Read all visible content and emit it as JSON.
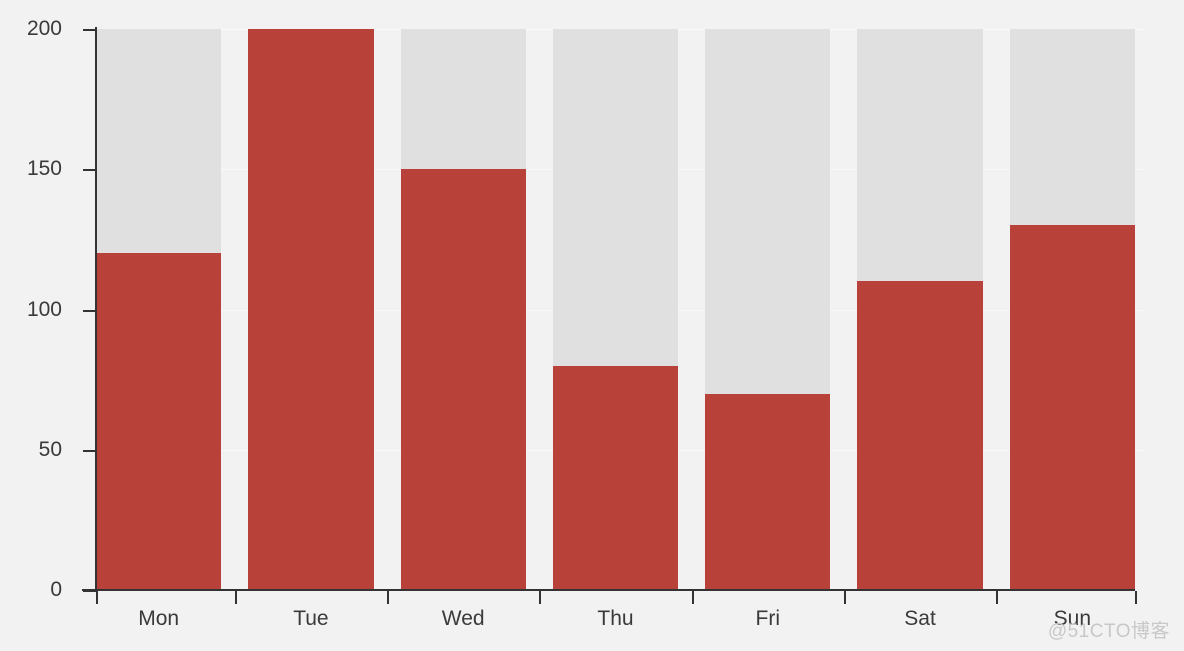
{
  "chart_data": {
    "type": "bar",
    "title": "",
    "subtitle": "",
    "xlabel": "",
    "ylabel": "",
    "categories": [
      "Mon",
      "Tue",
      "Wed",
      "Thu",
      "Fri",
      "Sat",
      "Sun"
    ],
    "values": [
      120,
      200,
      150,
      80,
      70,
      110,
      130
    ],
    "series": [
      {
        "name": "",
        "values": [
          120,
          200,
          150,
          80,
          70,
          110,
          130
        ]
      }
    ],
    "ylim": [
      0,
      200
    ],
    "yticks": [
      0,
      50,
      100,
      150,
      200
    ],
    "ytick_labels": [
      "0",
      "50",
      "100",
      "150",
      "200"
    ],
    "xtick_labels": [
      "Mon",
      "Tue",
      "Wed",
      "Thu",
      "Fri",
      "Sat",
      "Sun"
    ],
    "grid": true,
    "grid_axis": "y",
    "legend": false,
    "legend_position": "none",
    "annotations": [],
    "colors": {
      "bar": "#b8413a",
      "plot_band": "#e0e0e0",
      "background": "#f2f2f2",
      "axis": "#333333",
      "gridline": "#fafafa",
      "tick_label": "#3a3a3a"
    }
  },
  "watermark": {
    "text": "@51CTO博客"
  }
}
